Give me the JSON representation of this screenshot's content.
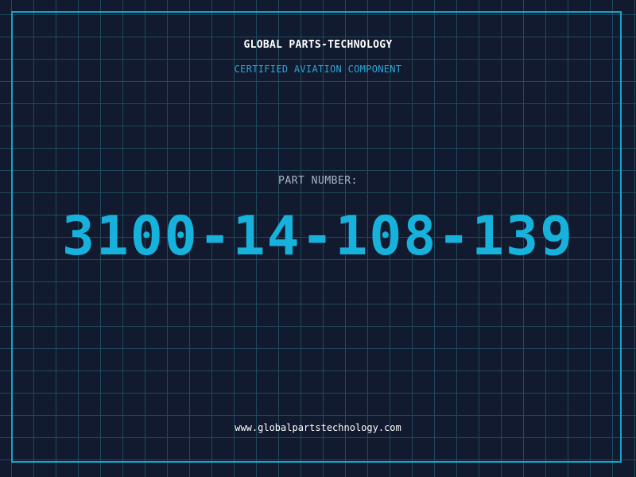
{
  "header": {
    "company": "GLOBAL PARTS-TECHNOLOGY",
    "tagline": "CERTIFIED AVIATION COMPONENT"
  },
  "part": {
    "label": "PART NUMBER:",
    "number": "3100-14-108-139"
  },
  "footer": {
    "url": "www.globalpartstechnology.com"
  },
  "colors": {
    "background": "#111a2e",
    "grid": "#1f4a5e",
    "accent": "#16a3c7",
    "text": "#ffffff",
    "muted": "#a9b6c9"
  }
}
